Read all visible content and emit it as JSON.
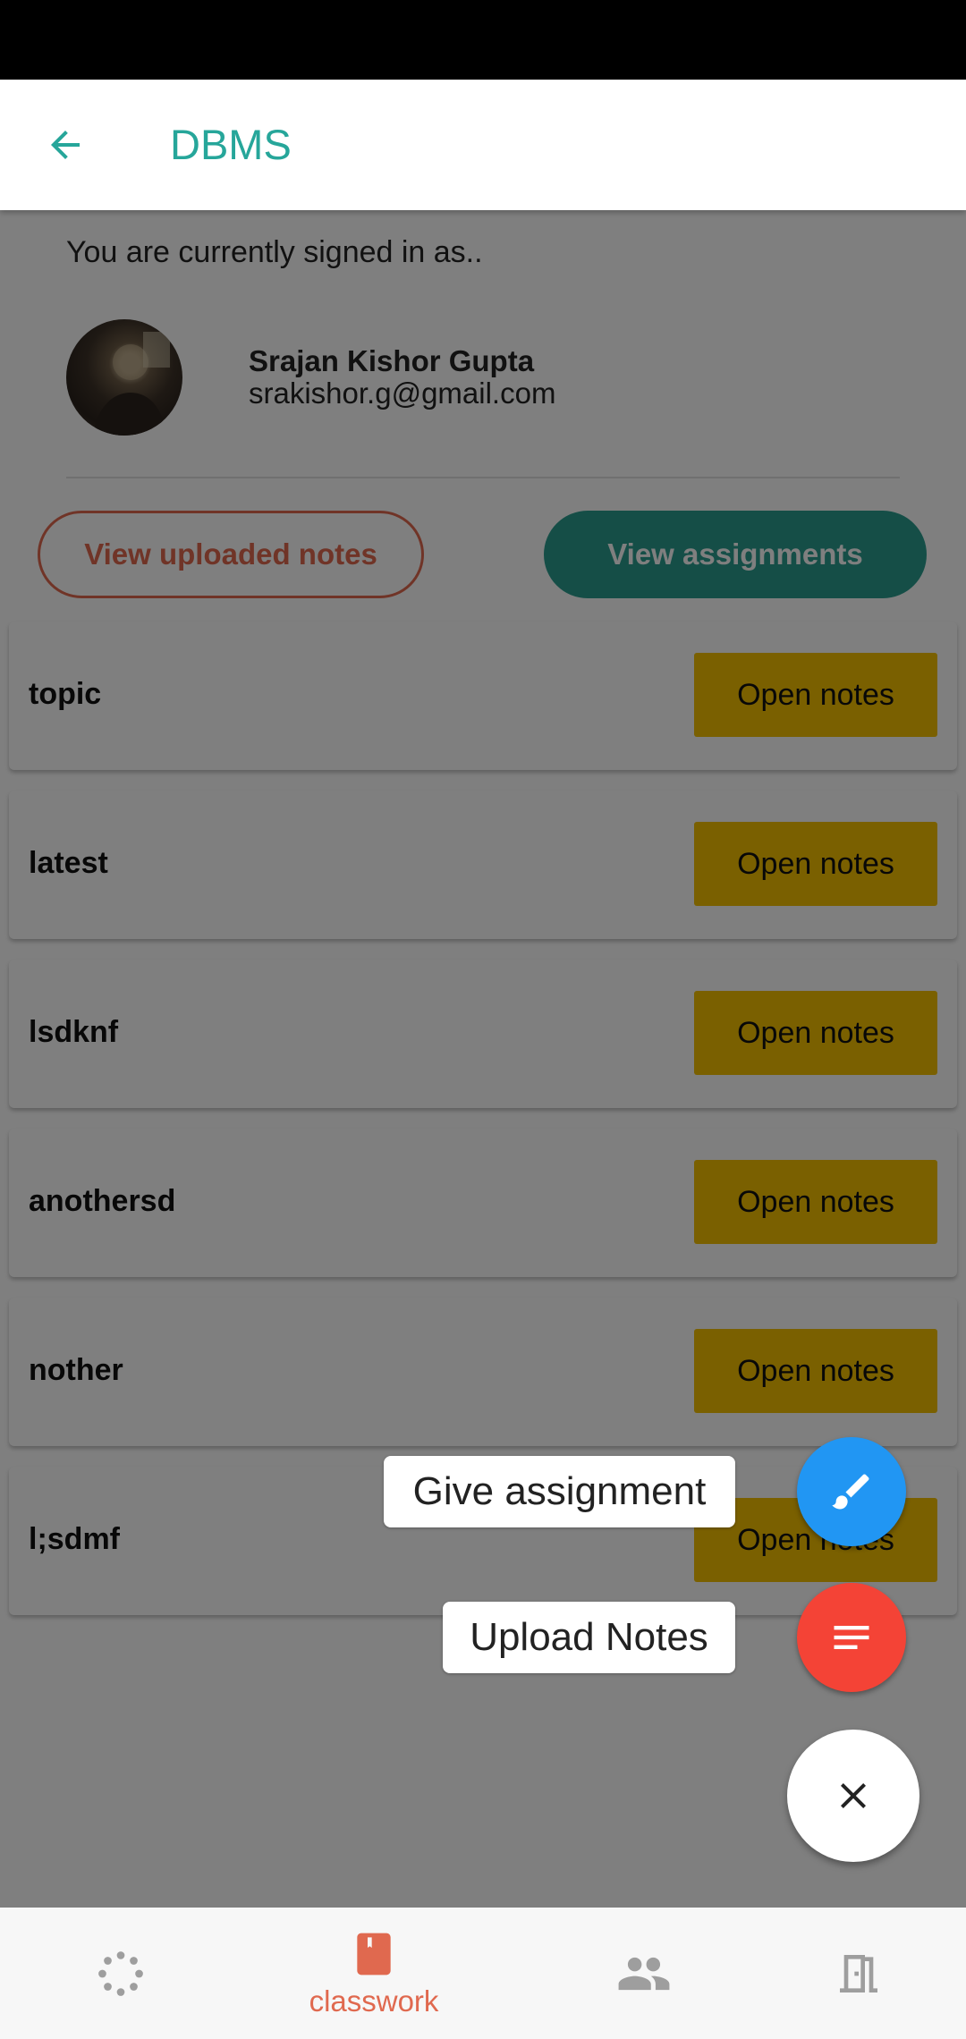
{
  "app_bar": {
    "title": "DBMS"
  },
  "profile": {
    "signed_in_text": "You are currently signed in as..",
    "name": "Srajan Kishor Gupta",
    "email": "srakishor.g@gmail.com"
  },
  "actions": {
    "view_uploaded_notes": "View uploaded notes",
    "view_assignments": "View assignments"
  },
  "notes": [
    {
      "title": "topic",
      "button": "Open notes"
    },
    {
      "title": "latest",
      "button": "Open notes"
    },
    {
      "title": "lsdknf",
      "button": "Open notes"
    },
    {
      "title": "anothersd",
      "button": "Open notes"
    },
    {
      "title": "nother",
      "button": "Open notes"
    },
    {
      "title": "l;sdmf",
      "button": "Open notes"
    }
  ],
  "fab": {
    "give_assignment": "Give assignment",
    "upload_notes": "Upload Notes"
  },
  "bottom_nav": {
    "items": [
      {
        "icon": "loading-icon",
        "label": ""
      },
      {
        "icon": "book-icon",
        "label": "classwork"
      },
      {
        "icon": "people-icon",
        "label": ""
      },
      {
        "icon": "exit-door-icon",
        "label": ""
      }
    ]
  },
  "colors": {
    "accent_teal": "#26a69a",
    "assignment_button": "#2a9d8f",
    "outline_accent": "#e0694f",
    "open_notes_button": "#f5c000",
    "fab_blue": "#2196f3",
    "fab_red": "#f44336"
  }
}
